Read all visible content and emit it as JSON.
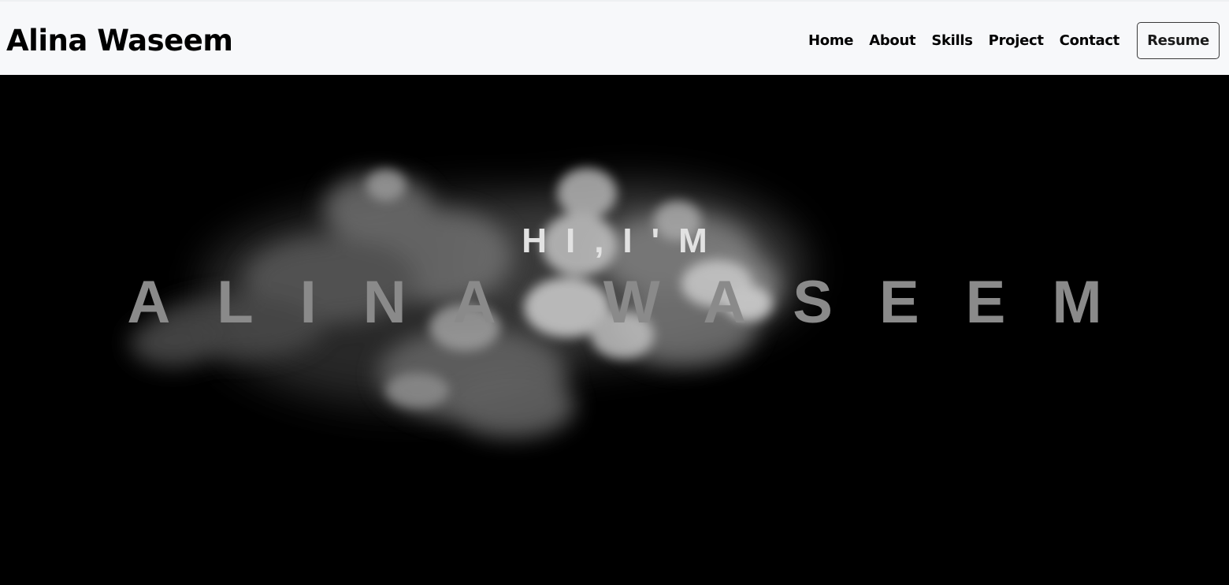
{
  "navbar": {
    "brand": "Alina Waseem",
    "links": [
      {
        "label": "Home"
      },
      {
        "label": "About"
      },
      {
        "label": "Skills"
      },
      {
        "label": "Project"
      },
      {
        "label": "Contact"
      }
    ],
    "resume_label": "Resume"
  },
  "hero": {
    "greeting": "HI,I'M",
    "name": "ALINA WASEEM",
    "background_image": "smoke-cloud"
  },
  "colors": {
    "navbar_bg": "#f7f8fa",
    "hero_bg": "#000000",
    "greeting_text": "#e2e2e2",
    "name_text": "#8a8a8a"
  }
}
